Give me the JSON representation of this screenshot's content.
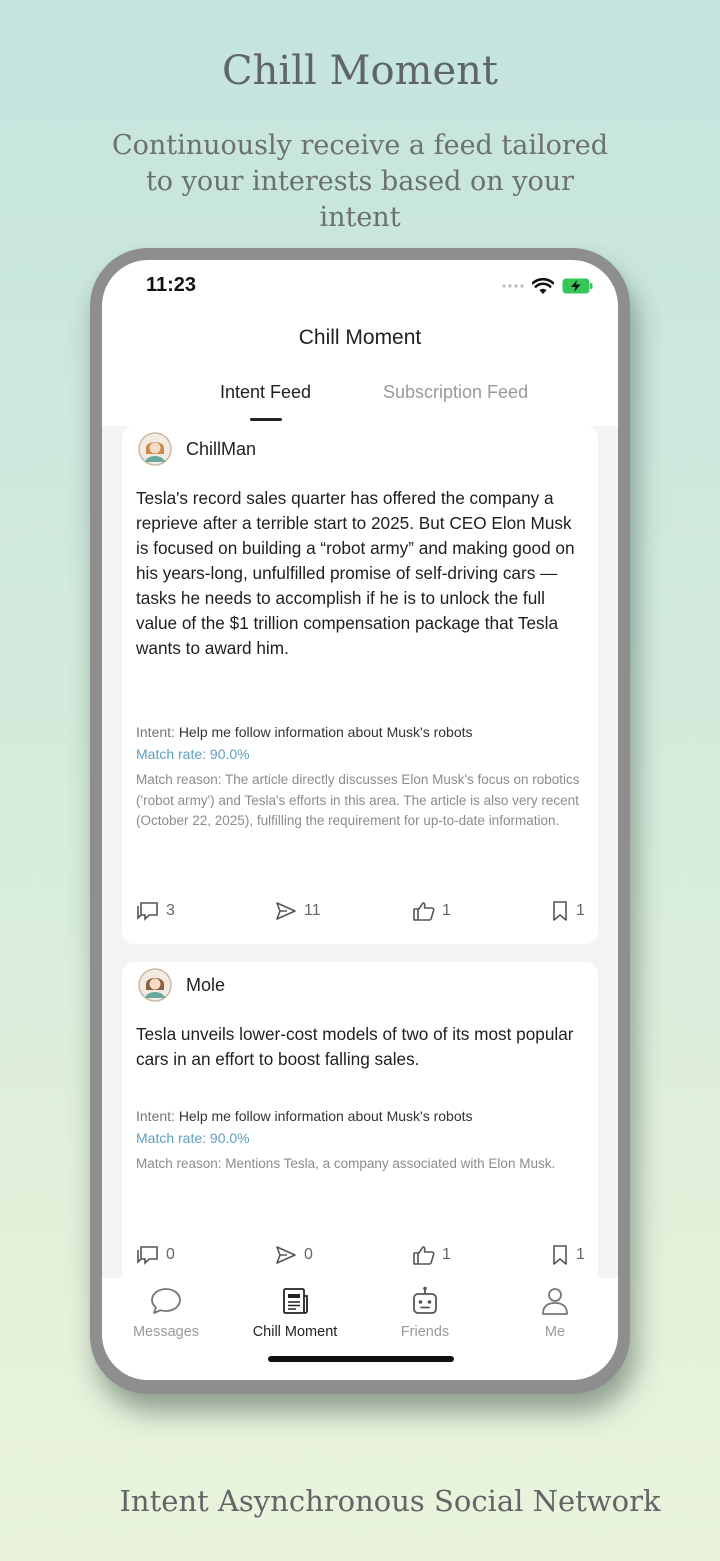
{
  "hero": {
    "title": "Chill Moment",
    "subtitle": "Continuously receive a feed tailored to your interests based on your intent"
  },
  "footer": {
    "tagline": "Intent Asynchronous Social Network"
  },
  "status_bar": {
    "time": "11:23"
  },
  "app": {
    "title": "Chill Moment"
  },
  "tabs": [
    {
      "label": "Intent Feed",
      "active": true
    },
    {
      "label": "Subscription Feed",
      "active": false
    }
  ],
  "posts": [
    {
      "username": "ChillMan",
      "body": "Tesla's record sales quarter has offered the company a reprieve after a terrible start to 2025. But CEO Elon Musk is focused on building a “robot army” and making good on his years-long, unfulfilled promise of self-driving cars — tasks he needs to accomplish if he is to unlock the full value of the $1 trillion compensation package that Tesla wants to award him.",
      "intent_label": "Intent:",
      "intent": "Help me follow information about Musk's robots",
      "match_rate": "Match rate: 90.0%",
      "match_reason": "Match reason: The article directly discusses Elon Musk's focus on robotics ('robot army') and Tesla's efforts in this area. The article is also very recent (October 22, 2025), fulfilling the requirement for up-to-date information.",
      "comments": "3",
      "shares": "11",
      "likes": "1",
      "bookmarks": "1"
    },
    {
      "username": "Mole",
      "body": "Tesla unveils lower-cost models of two of its most popular cars in an effort to boost falling sales.",
      "intent_label": "Intent:",
      "intent": "Help me follow information about Musk's robots",
      "match_rate": "Match rate: 90.0%",
      "match_reason": "Match reason: Mentions Tesla, a company associated with Elon Musk.",
      "comments": "0",
      "shares": "0",
      "likes": "1",
      "bookmarks": "1"
    }
  ],
  "bottom_nav": [
    {
      "label": "Messages",
      "icon": "chat-bubble-icon",
      "active": false
    },
    {
      "label": "Chill Moment",
      "icon": "newspaper-icon",
      "active": true
    },
    {
      "label": "Friends",
      "icon": "robot-icon",
      "active": false
    },
    {
      "label": "Me",
      "icon": "person-icon",
      "active": false
    }
  ],
  "colors": {
    "accent_match": "#5b9fc2",
    "battery": "#35c759",
    "background_top": "#c5e4de",
    "background_bottom": "#eaf4dd"
  }
}
